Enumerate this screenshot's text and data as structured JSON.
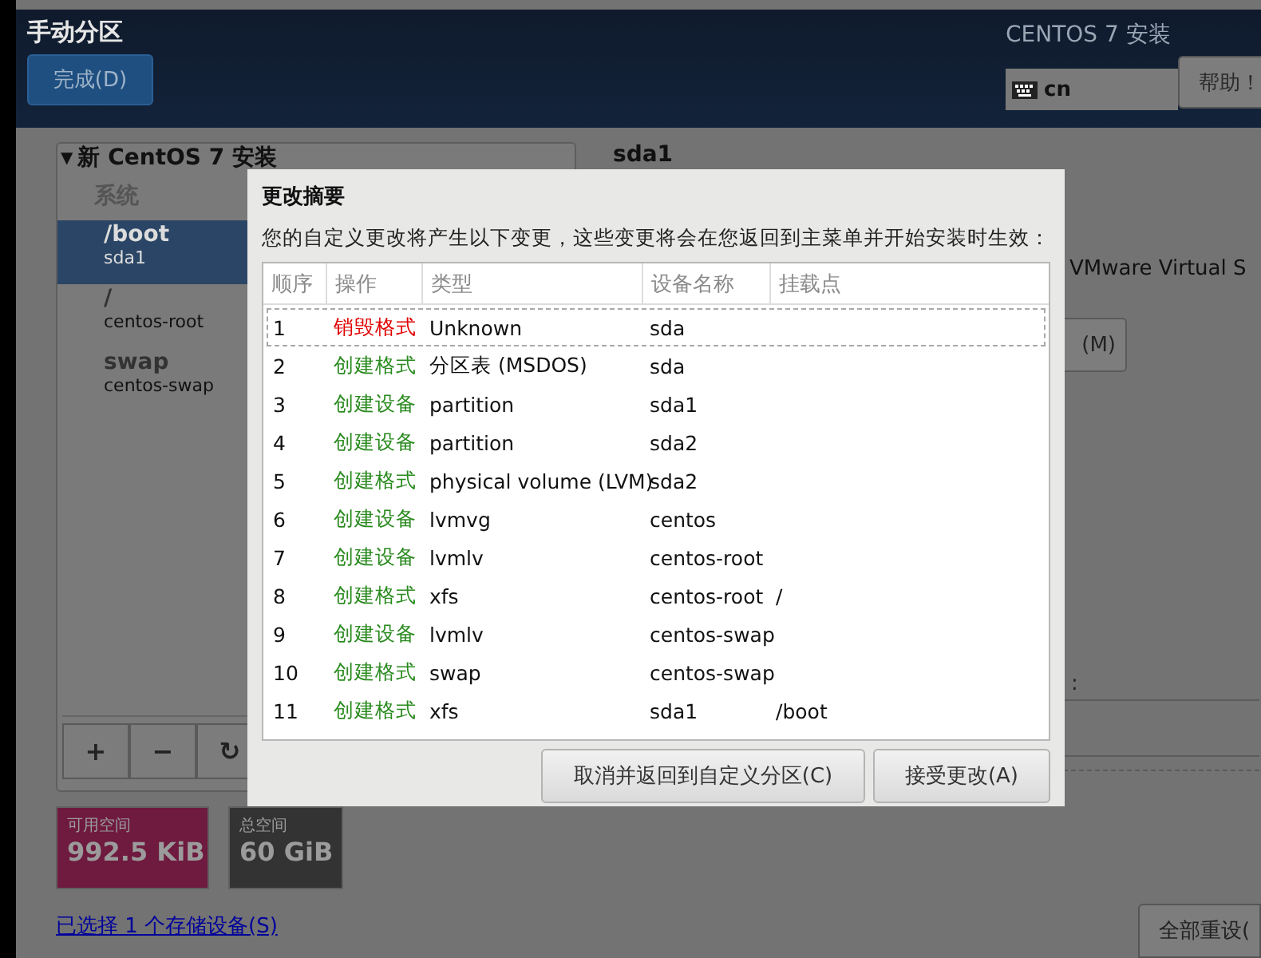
{
  "header": {
    "title": "手动分区",
    "done_button": "完成(D)",
    "product": "CENTOS 7 安装",
    "keyboard": "cn",
    "help_button": "帮助！"
  },
  "sidebar": {
    "expander": "▼",
    "heading": "新 CentOS 7 安装",
    "group": "系统",
    "items": [
      {
        "name": "/boot",
        "device": "sda1",
        "selected": true
      },
      {
        "name": "/",
        "device": "centos-root",
        "selected": false
      },
      {
        "name": "swap",
        "device": "centos-swap",
        "selected": false
      }
    ],
    "toolbar": [
      "+",
      "−",
      "↻"
    ]
  },
  "space": [
    {
      "label": "可用空间",
      "value": "992.5 KiB",
      "kind": "free"
    },
    {
      "label": "总空间",
      "value": "60 GiB",
      "kind": "total"
    }
  ],
  "storage_link": "已选择 1 个存储设备(S)",
  "detail": {
    "title": "sda1",
    "device_text": "VMware Virtual S",
    "button": "(M)",
    "colon": ":",
    "reset_button": "全部重设("
  },
  "dialog": {
    "title": "更改摘要",
    "message": "您的自定义更改将产生以下变更，这些变更将会在您返回到主菜单并开始安装时生效：",
    "columns": [
      "顺序",
      "操作",
      "类型",
      "设备名称",
      "挂载点"
    ],
    "rows": [
      {
        "order": "1",
        "action": "销毁格式",
        "kind": "destroy",
        "type": "Unknown",
        "device": "sda",
        "focused": true
      },
      {
        "order": "2",
        "action": "创建格式",
        "kind": "create",
        "type": "分区表 (MSDOS)",
        "device": "sda",
        "focused": false
      },
      {
        "order": "3",
        "action": "创建设备",
        "kind": "create",
        "type": "partition",
        "device": "sda1",
        "focused": false
      },
      {
        "order": "4",
        "action": "创建设备",
        "kind": "create",
        "type": "partition",
        "device": "sda2",
        "focused": false
      },
      {
        "order": "5",
        "action": "创建格式",
        "kind": "create",
        "type": "physical volume (LVM)",
        "device": "sda2",
        "focused": false
      },
      {
        "order": "6",
        "action": "创建设备",
        "kind": "create",
        "type": "lvmvg",
        "device": "centos",
        "focused": false
      },
      {
        "order": "7",
        "action": "创建设备",
        "kind": "create",
        "type": "lvmlv",
        "device": "centos-root",
        "focused": false
      },
      {
        "order": "8",
        "action": "创建格式",
        "kind": "create",
        "type": "xfs",
        "device": "centos-root",
        "mount": "/",
        "focused": false
      },
      {
        "order": "9",
        "action": "创建设备",
        "kind": "create",
        "type": "lvmlv",
        "device": "centos-swap",
        "focused": false
      },
      {
        "order": "10",
        "action": "创建格式",
        "kind": "create",
        "type": "swap",
        "device": "centos-swap",
        "focused": false
      },
      {
        "order": "11",
        "action": "创建格式",
        "kind": "create",
        "type": "xfs",
        "device": "sda1",
        "mount": "/boot",
        "focused": false
      }
    ],
    "buttons": [
      "取消并返回到自定义分区(C)",
      "接受更改(A)"
    ]
  }
}
